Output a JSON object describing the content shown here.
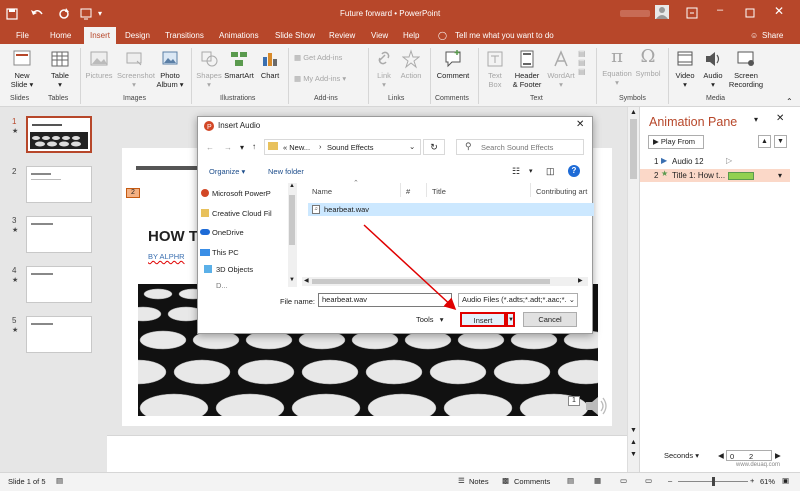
{
  "titlebar": {
    "autosave_icon": "save-icon",
    "doc_title": "Future forward  •  PowerPoint"
  },
  "tabs": [
    "File",
    "Home",
    "Insert",
    "Design",
    "Transitions",
    "Animations",
    "Slide Show",
    "Review",
    "View",
    "Help"
  ],
  "tell_me": "Tell me what you want to do",
  "share": "Share",
  "ribbon": {
    "new_slide": "New",
    "new_slide2": "Slide",
    "table": "Table",
    "pictures": "Pictures",
    "screenshot": "Screenshot",
    "photo_album": "Photo",
    "photo_album2": "Album",
    "shapes": "Shapes",
    "smartart": "SmartArt",
    "chart": "Chart",
    "get_addins": "Get Add-ins",
    "my_addins": "My Add-ins",
    "link": "Link",
    "action": "Action",
    "comment": "Comment",
    "textbox": "Text",
    "textbox2": "Box",
    "header_footer": "Header",
    "header_footer2": "& Footer",
    "wordart": "WordArt",
    "equation": "Equation",
    "symbol": "Symbol",
    "video": "Video",
    "audio": "Audio",
    "screen_recording": "Screen",
    "screen_recording2": "Recording",
    "groups": [
      "Slides",
      "Tables",
      "Images",
      "Illustrations",
      "Add-ins",
      "Links",
      "Comments",
      "Text",
      "Symbols",
      "Media"
    ]
  },
  "slides": [
    "1",
    "2",
    "3",
    "4",
    "5"
  ],
  "slide": {
    "badge": "2",
    "title": "HOW T",
    "byline": "BY ALPHR",
    "slide_num": "1"
  },
  "anim_pane": {
    "title": "Animation Pane",
    "play_from": "Play From",
    "item1_num": "1",
    "item1": "Audio 12",
    "item2_num": "2",
    "item2": "Title 1: How t...",
    "seconds": "Seconds",
    "zoom_a": "0",
    "zoom_b": "2"
  },
  "status": {
    "slide_of": "Slide 1 of 5",
    "notes": "Notes",
    "comments": "Comments",
    "zoom": "61%"
  },
  "dialog": {
    "title": "Insert Audio",
    "path": [
      "«  New...",
      "Sound Effects"
    ],
    "search_placeholder": "Search Sound Effects",
    "organize": "Organize",
    "new_folder": "New folder",
    "nav": [
      "Microsoft PowerP",
      "Creative Cloud Fil",
      "OneDrive",
      "This PC",
      "3D Objects",
      "D..."
    ],
    "columns": [
      "Name",
      "#",
      "Title",
      "Contributing art"
    ],
    "file": "hearbeat.wav",
    "file_name_label": "File name:",
    "file_name_value": "hearbeat.wav",
    "filter": "Audio Files (*.adts;*.adt;*.aac;*.",
    "tools": "Tools",
    "insert": "Insert",
    "cancel": "Cancel"
  },
  "watermark": "www.deuaq.com",
  "colors": {
    "accent": "#b7472a",
    "highlight": "#e00000"
  }
}
